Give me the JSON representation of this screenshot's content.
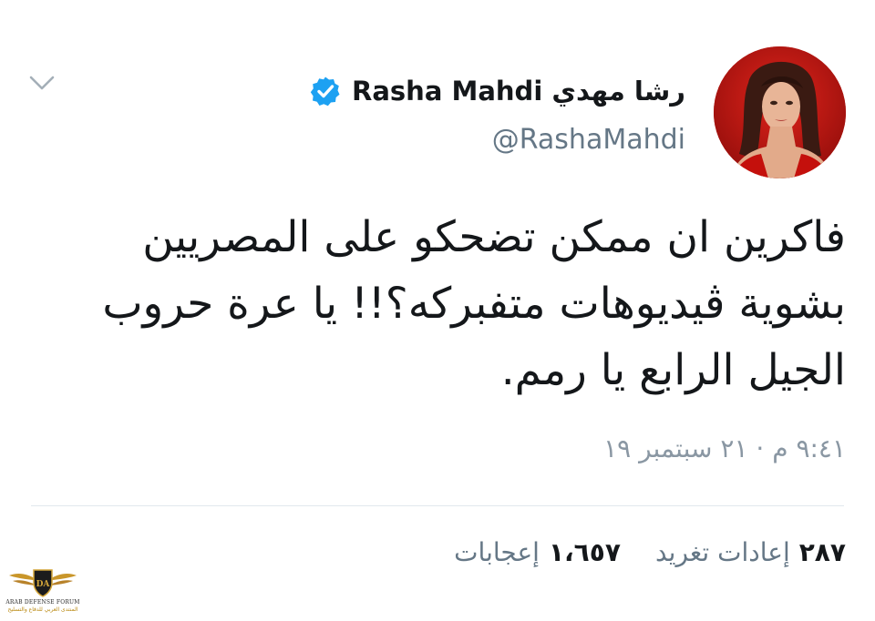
{
  "header": {
    "display_name": "رشا مهدي Rasha Mahdi",
    "handle": "@RashaMahdi",
    "verified": true,
    "verified_color": "#1da1f2"
  },
  "tweet": {
    "text": "فاكرين ان ممكن تضحكو على المصريين بشوية ڤيديوهات متفبركه؟!! يا عرة حروب الجيل الرابع يا رمم.",
    "timestamp": "٩:٤١ م · ٢١ سبتمبر ١٩"
  },
  "stats": {
    "retweets_count": "٢٨٧",
    "retweets_label": "إعادات تغريد",
    "likes_count": "١،٦٥٧",
    "likes_label": "إعجابات"
  },
  "icons": {
    "menu": "chevron-down-icon",
    "verified": "verified-badge-icon"
  },
  "watermark": {
    "line1": "ARAB DEFENSE FORUM",
    "line2": "المنتدى العربي للدفاع والتسليح",
    "badge_text": "DA"
  },
  "colors": {
    "text_primary": "#14171a",
    "text_secondary": "#657786",
    "divider": "#e1e8ed",
    "avatar_background": "#b8120f"
  }
}
